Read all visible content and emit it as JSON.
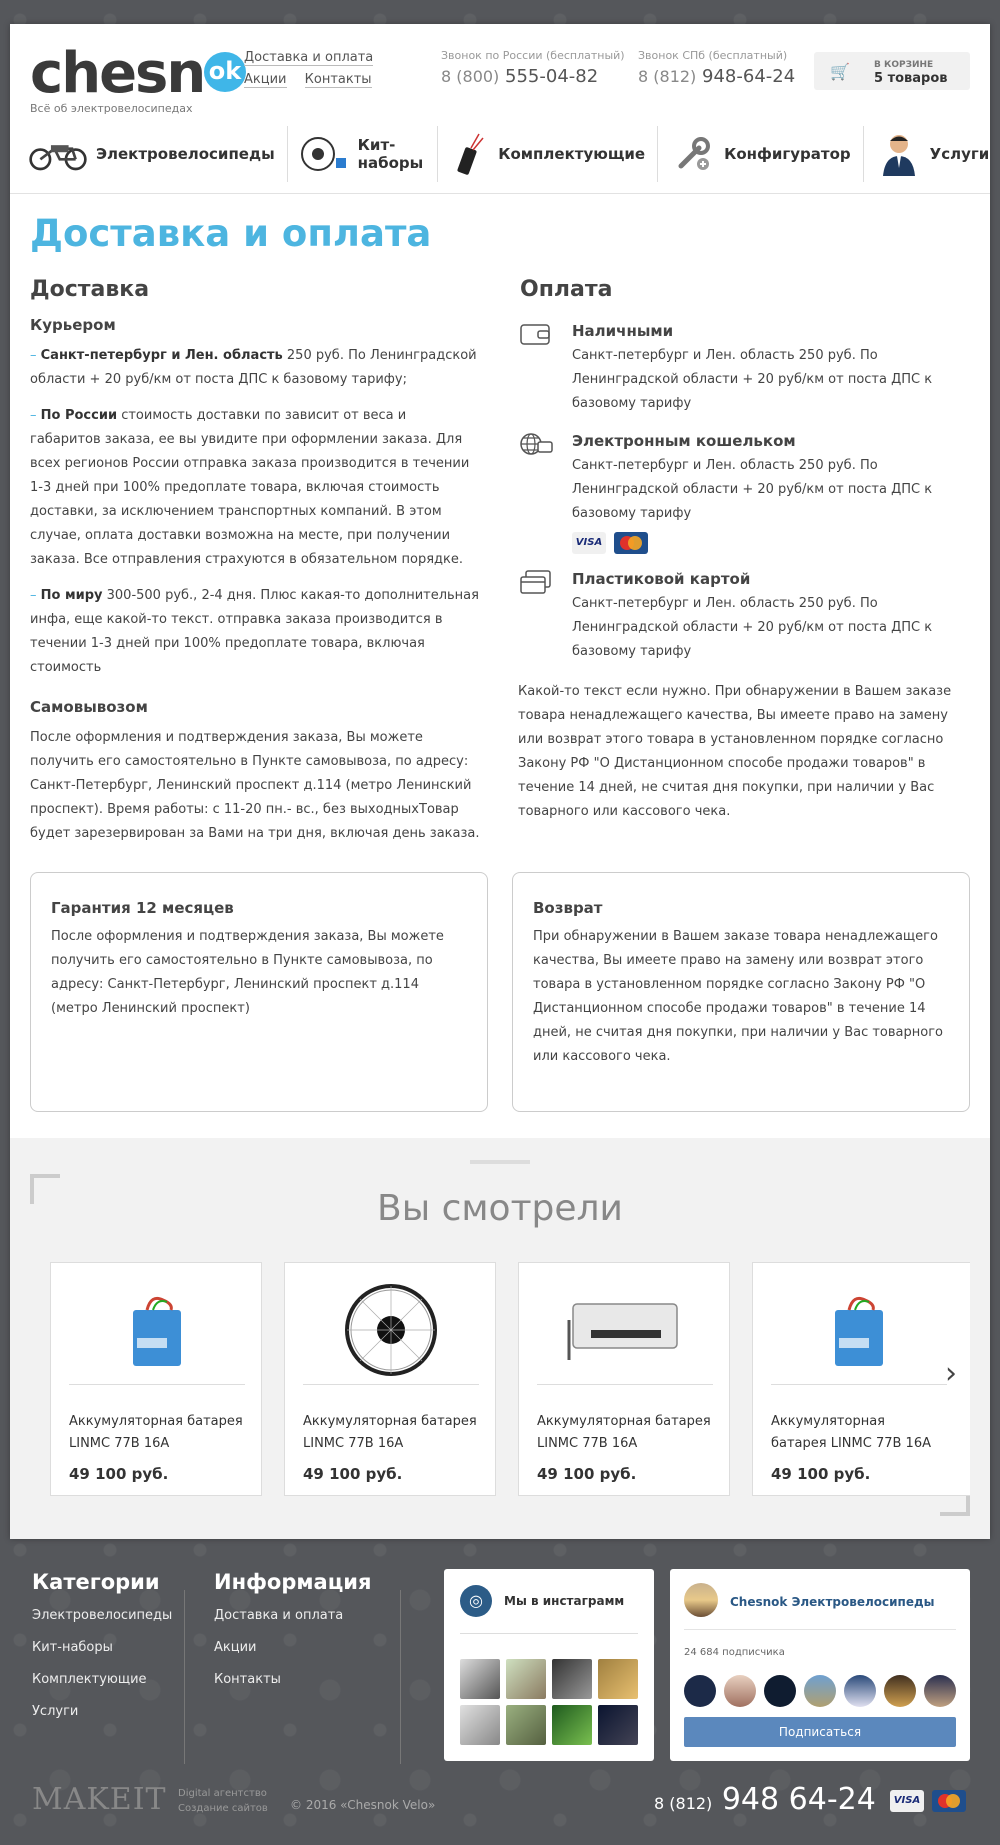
{
  "header": {
    "logo_word": "chesn",
    "logo_bubble": "ok",
    "logo_tagline": "Всё об электровелосипедах",
    "links": [
      "Доставка и оплата",
      "Акции",
      "Контакты"
    ],
    "phone_russia": {
      "caption": "Звонок по России (бесплатный)",
      "code": "8 (800)",
      "number": "555-04-82"
    },
    "phone_spb": {
      "caption": "Звонок СПб (бесплатный)",
      "code": "8 (812)",
      "number": "948-64-24"
    },
    "cart": {
      "caption": "В КОРЗИНЕ",
      "count": "5 товаров"
    }
  },
  "nav": [
    {
      "label": "Электровелосипеды",
      "icon": "ebike-icon"
    },
    {
      "label": "Кит-наборы",
      "icon": "kit-icon"
    },
    {
      "label": "Комплектующие",
      "icon": "parts-icon"
    },
    {
      "label": "Конфигуратор",
      "icon": "wrench-icon"
    },
    {
      "label": "Услуги",
      "icon": "service-person-icon"
    }
  ],
  "page": {
    "title": "Доставка и оплата",
    "delivery": {
      "heading": "Доставка",
      "courier_heading": "Курьером",
      "spb_bold": "Санкт-петербург и Лен. область",
      "spb_text": " 250 руб. По Ленинградской области + 20 руб/км от поста ДПС к базовому тарифу;",
      "russia_bold": "По России",
      "russia_text": " стоимость доставки по зависит от веса и габаритов заказа, ее вы увидите при оформлении заказа. Для всех регионов России отправка заказа производится в течении 1-3 дней при 100% предоплате товара, включая стоимость доставки, за исключением транспортных компаний. В этом случае, оплата доставки возможна на месте, при получении заказа. Все отправления страхуются в обязательном порядке.",
      "world_bold": "По миру",
      "world_text": " 300-500 руб., 2-4 дня. Плюс какая-то дополнительная инфа, еще какой-то текст. отправка заказа производится в течении 1-3 дней при 100% предоплате товара, включая стоимость",
      "pickup_heading": "Самовывозом",
      "pickup_text": "После оформления и подтверждения заказа, Вы можете получить его самостоятельно в Пункте самовывоза, по адресу: Санкт-Петербург, Ленинский проспект д.114 (метро Ленинский проспект). Время работы: с 11-20 пн.- вс., без выходныхТовар будет зарезервирован за Вами на три дня, включая день заказа."
    },
    "payment": {
      "heading": "Оплата",
      "methods": [
        {
          "title": "Наличными",
          "icon": "wallet-icon",
          "text": "Санкт-петербург и Лен. область  250 руб. По Ленинградской области + 20 руб/км от поста ДПС к базовому тарифу"
        },
        {
          "title": "Электронным кошельком",
          "icon": "globe-icon",
          "text": "Санкт-петербург и Лен. область  250 руб. По Ленинградской области + 20 руб/км от поста ДПС к базовому тарифу"
        },
        {
          "title": "Пластиковой картой",
          "icon": "credit-card-icon",
          "text": "Санкт-петербург и Лен. область  250 руб. По Ленинградской области + 20 руб/км от поста ДПС к базовому тарифу"
        }
      ],
      "card_visa": "VISA",
      "note": "Какой-то текст если нужно. При обнаружении в Вашем заказе товара ненадлежащего качества, Вы имеете право на замену или возврат этого товара в установленном порядке согласно Закону РФ \"О Дистанционном способе продажи товаров\" в течение 14 дней, не считая дня покупки, при наличии у Вас товарного или кассового чека."
    },
    "guarantee": {
      "title": "Гарантия 12 месяцев",
      "text": "После оформления и подтверждения заказа, Вы можете получить его самостоятельно в Пункте самовывоза, по адресу: Санкт-Петербург, Ленинский проспект д.114 (метро Ленинский проспект)"
    },
    "return": {
      "title": "Возврат",
      "text": "При обнаружении в Вашем заказе товара ненадлежащего качества, Вы имеете право на замену или возврат этого товара в установленном порядке согласно Закону РФ \"О Дистанционном способе продажи товаров\" в течение 14 дней, не считая дня покупки, при наличии у Вас товарного или кассового чека."
    }
  },
  "seen": {
    "title": "Вы смотрели",
    "products": [
      {
        "name": "Аккумуляторная батарея LINMC 77В 16А",
        "price": "49 100 руб.",
        "image": "battery"
      },
      {
        "name": "Аккумуляторная батарея LINMC 77В 16А",
        "price": "49 100 руб.",
        "image": "wheel"
      },
      {
        "name": "Аккумуляторная батарея LINMC 77В 16А",
        "price": "49 100 руб.",
        "image": "controller"
      },
      {
        "name": "Аккумуляторная батарея LINMC 77В 16А",
        "price": "49 100 руб.",
        "image": "battery"
      }
    ]
  },
  "footer": {
    "categories_heading": "Категории",
    "categories": [
      "Электровелосипеды",
      "Кит-наборы",
      "Комплектующие",
      "Услуги"
    ],
    "info_heading": "Информация",
    "info": [
      "Доставка и оплата",
      "Акции",
      "Контакты"
    ],
    "instagram_title": "Мы в инстаграмм",
    "vk_name": "Chesnok Электровелосипеды",
    "vk_subscribers": "24 684 подписчика",
    "vk_button": "Подписаться",
    "makeit": "MAKEIT",
    "makeit_sub1": "Digital агентство",
    "makeit_sub2": "Создание сайтов",
    "copyright": "© 2016 «Chesnok Velo»",
    "phone_code": "8 (812)",
    "phone_number": "948 64-24"
  }
}
